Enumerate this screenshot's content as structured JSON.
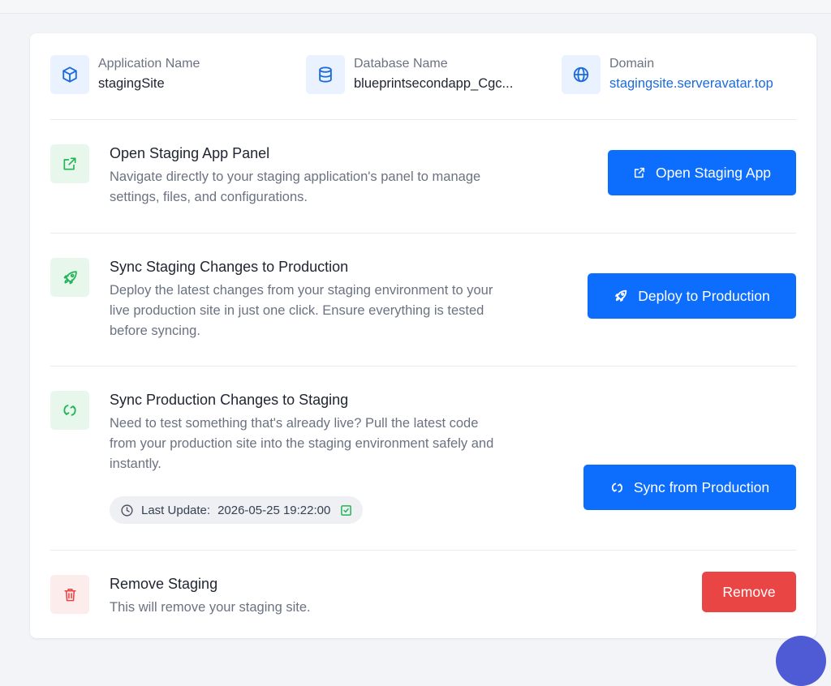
{
  "info": {
    "application": {
      "label": "Application Name",
      "value": "stagingSite",
      "icon": "cube-icon"
    },
    "database": {
      "label": "Database Name",
      "value": "blueprintsecondapp_Cgc...",
      "icon": "database-icon"
    },
    "domain": {
      "label": "Domain",
      "value": "stagingsite.serveravatar.top",
      "icon": "globe-icon"
    }
  },
  "sections": {
    "open_app": {
      "title": "Open Staging App Panel",
      "desc_line1": "Navigate directly to your staging application's panel to manage",
      "desc_line2": "settings, files, and configurations.",
      "button": "Open Staging App"
    },
    "deploy": {
      "title": "Sync Staging Changes to Production",
      "desc_line1": "Deploy the latest changes from your staging environment to your",
      "desc_line2": "live production site in just one click. Ensure everything is tested",
      "desc_line3": "before syncing.",
      "button": "Deploy to Production"
    },
    "sync": {
      "title": "Sync Production Changes to Staging",
      "desc_line1": "Need to test something that's already live? Pull the latest code",
      "desc_line2": "from your production site into the staging environment safely and",
      "desc_line3": "instantly.",
      "button": "Sync from Production",
      "last_update_label": "Last Update:",
      "last_update_value": "2026-05-25 19:22:00"
    },
    "remove": {
      "title": "Remove Staging",
      "desc_line1": "This will remove your staging site.",
      "button": "Remove"
    }
  },
  "colors": {
    "primary": "#0d6efd",
    "danger": "#ea4545",
    "success": "#22b455",
    "link": "#1a6bdc"
  }
}
